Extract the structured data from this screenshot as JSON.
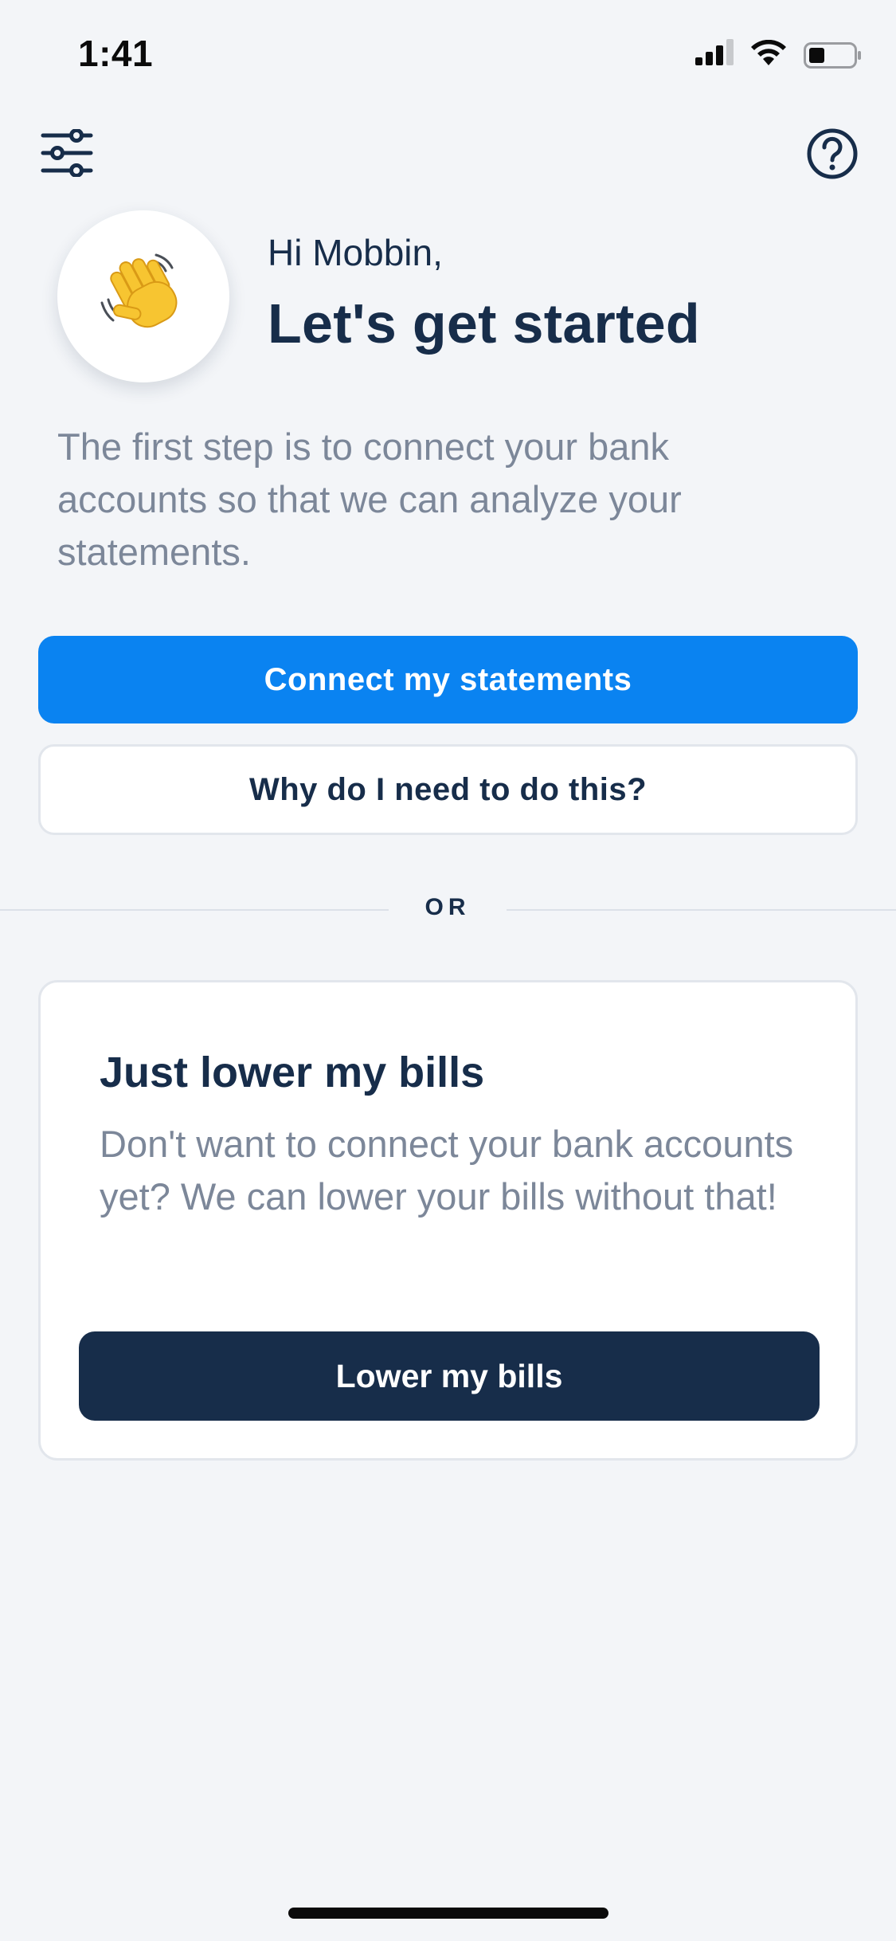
{
  "status_bar": {
    "time": "1:41",
    "icons": [
      "cellular-signal-icon",
      "wifi-icon",
      "battery-icon"
    ]
  },
  "nav": {
    "left_icon": "filters-icon",
    "right_icon": "help-icon"
  },
  "header": {
    "avatar_icon": "waving-hand-icon",
    "greeting": "Hi Mobbin,",
    "title": "Let's get started"
  },
  "intro": {
    "text": "The first step is to connect your bank accounts so that we can analyze your statements."
  },
  "actions": {
    "connect_label": "Connect my statements",
    "why_label": "Why do I need to do this?"
  },
  "divider": {
    "label": "OR"
  },
  "card": {
    "title": "Just lower my bills",
    "body": "Don't want to connect your bank accounts yet? We can lower your bills without that!",
    "button_label": "Lower my bills"
  },
  "colors": {
    "background": "#f3f5f8",
    "primary_blue": "#0a83f1",
    "navy": "#172d4a",
    "muted_text": "#7c8799",
    "waving_hand": "#f7c531"
  }
}
